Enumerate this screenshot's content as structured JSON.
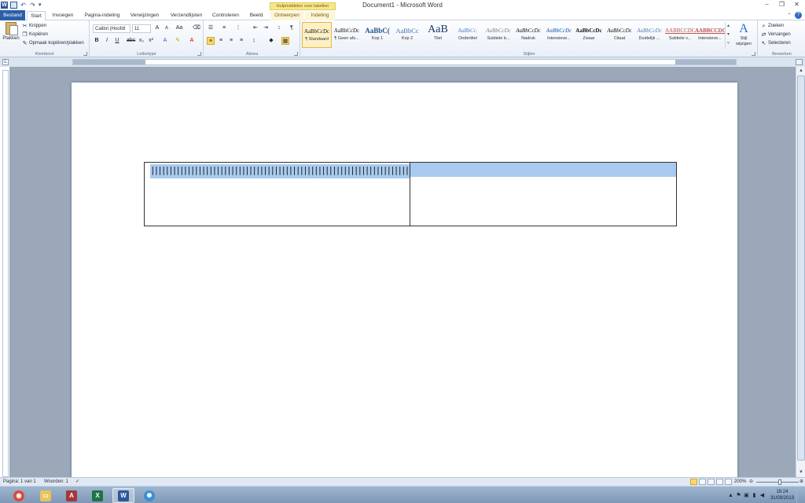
{
  "window": {
    "title": "Document1 - Microsoft Word",
    "contextual_header": "Hulpmiddelen voor tabellen"
  },
  "tabs": [
    {
      "label": "Bestand"
    },
    {
      "label": "Start"
    },
    {
      "label": "Invoegen"
    },
    {
      "label": "Pagina-indeling"
    },
    {
      "label": "Verwijzingen"
    },
    {
      "label": "Verzendlijsten"
    },
    {
      "label": "Controleren"
    },
    {
      "label": "Beeld"
    },
    {
      "label": "Ontwerpen"
    },
    {
      "label": "Indeling"
    }
  ],
  "clipboard": {
    "paste": "Plakken",
    "cut": "Knippen",
    "copy": "Kopiëren",
    "format_painter": "Opmaak kopiëren/plakken",
    "label": "Klembord"
  },
  "font": {
    "name": "Calibri (Hoofdt",
    "size": "11",
    "label": "Lettertype"
  },
  "paragraph": {
    "label": "Alinea"
  },
  "styles": {
    "label": "Stijlen",
    "items": [
      {
        "sample": "AaBbCcDc",
        "name": "¶ Standaard"
      },
      {
        "sample": "AaBbCcDc",
        "name": "¶ Geen afs..."
      },
      {
        "sample": "AaBbC(",
        "name": "Kop 1"
      },
      {
        "sample": "AaBbCc",
        "name": "Kop 2"
      },
      {
        "sample": "AaB",
        "name": "Titel"
      },
      {
        "sample": "AaBbCc.",
        "name": "Ondertitel"
      },
      {
        "sample": "AaBbCcDc",
        "name": "Subtiele b..."
      },
      {
        "sample": "AaBbCcDc",
        "name": "Nadruk"
      },
      {
        "sample": "AaBbCcDc",
        "name": "Intensieve..."
      },
      {
        "sample": "AaBbCcDc",
        "name": "Zwaar"
      },
      {
        "sample": "AaBbCcDc",
        "name": "Citaat"
      },
      {
        "sample": "AaBbCcDc",
        "name": "Duidelijk ..."
      },
      {
        "sample": "AABBCCDC",
        "name": "Subtiele v..."
      },
      {
        "sample": "AABBCCDC",
        "name": "Intensieve..."
      }
    ],
    "change_label_1": "Stijl",
    "change_label_2": "wijzigen"
  },
  "editing": {
    "find": "Zoeken",
    "replace": "Vervangen",
    "select": "Selecteren",
    "label": "Bewerken"
  },
  "document": {
    "cell1_text": "||||||||||||||||||||||||||||||||||||||||||||||||||||||||||||||||||||||||||||||||||||||||||||||||||||||"
  },
  "statusbar": {
    "page": "Pagina: 1 van 1",
    "words": "Woorden: 1",
    "zoom": "200%"
  },
  "clock": {
    "time": "19:24",
    "date": "31/08/2013"
  },
  "colors": {
    "accent": "#2b579a",
    "highlight": "#a8cbef",
    "contextual": "#f6e78a"
  }
}
